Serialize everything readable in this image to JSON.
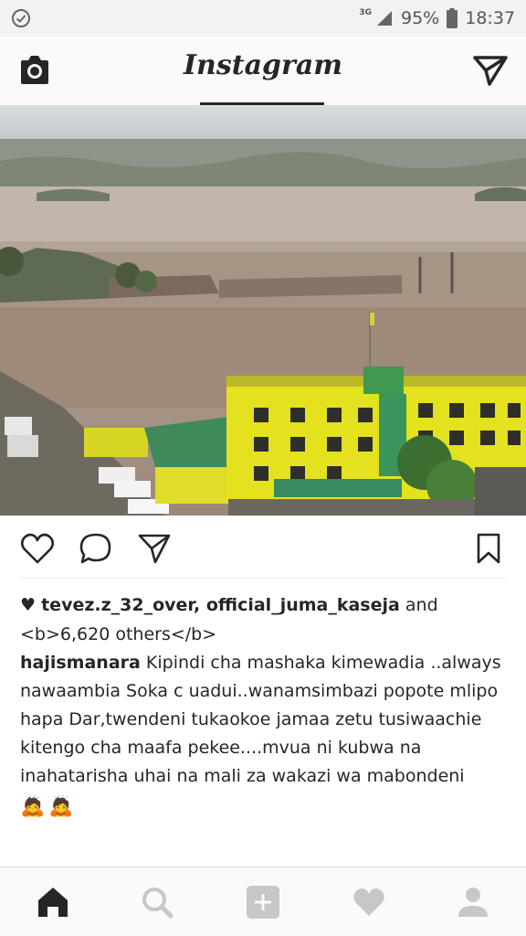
{
  "status_bar": {
    "network": "3G",
    "battery": "95%",
    "time": "18:37",
    "icons": [
      "check-circle-icon",
      "signal-icon",
      "battery-icon"
    ]
  },
  "header": {
    "title": "Instagram",
    "icons": [
      "camera-icon",
      "direct-message-icon"
    ]
  },
  "post": {
    "likes": {
      "prefix_icon": "heart-icon",
      "users": "tevez.z_32_over, official_juma_kaseja",
      "and": "and",
      "others": "<b>6,620 others</b>"
    },
    "caption": {
      "username": "hajismanara",
      "text": "Kipindi cha mashaka kimewadia ..always nawaambia Soka c uadui..wanamsimbazi popote mlipo hapa Dar,twendeni tukaokoe jamaa zetu tusiwaachie kitengo cha maafa pekee....mvua ni kubwa na inahatarisha uhai na mali za wakazi wa mabondeni",
      "emojis": [
        "🙇",
        "🙇"
      ]
    },
    "actions": [
      "like-icon",
      "comment-icon",
      "share-icon",
      "bookmark-icon"
    ]
  },
  "bottom_nav": [
    "home-icon",
    "search-icon",
    "add-post-icon",
    "activity-icon",
    "profile-icon"
  ],
  "colors": {
    "status_bar": "#f2f2f2",
    "header_bg": "#fafafa",
    "text": "#262626",
    "icon_gray": "#c7c7c7",
    "building_yellow": "#e4e11f",
    "flood_water": "#9e8a78"
  }
}
